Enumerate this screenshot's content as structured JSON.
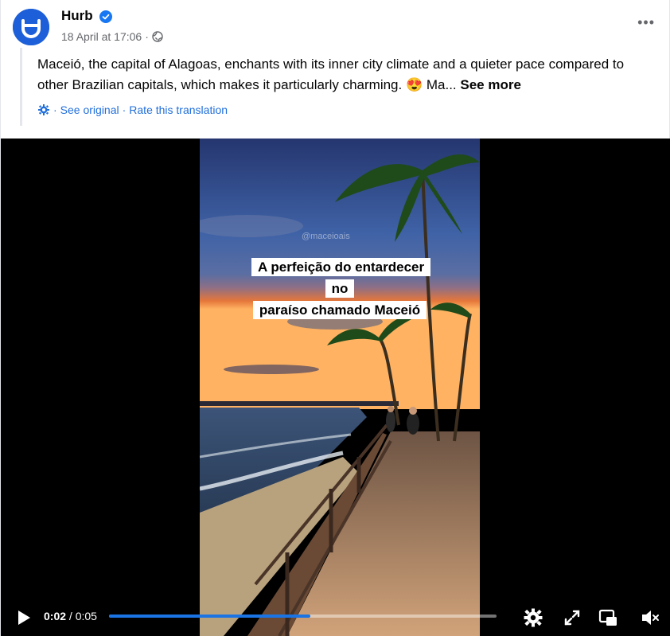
{
  "post": {
    "author": "Hurb",
    "date": "18 April at 17:06",
    "separator": "·",
    "text": "Maceió, the capital of Alagoas, enchants with its inner city climate and a quieter pace compared to other Brazilian capitals, which makes it particularly charming. 😍 Ma...",
    "see_more": "See more",
    "translation": {
      "see_original": "See original",
      "rate": "Rate this translation"
    }
  },
  "video": {
    "overlay_line1": "A perfeição do entardecer no",
    "overlay_line2": "paraíso chamado Maceió",
    "watermark": "@maceioais",
    "current_time": "0:02",
    "duration": "0:05",
    "time_sep": " / ",
    "progress_fraction": 0.52
  },
  "icons": {
    "avatar": "hurb-logo-icon",
    "verified": "verified-badge-icon",
    "privacy": "globe-icon",
    "more": "more-options-icon",
    "translate": "gear-icon",
    "play": "play-icon",
    "settings": "settings-gear-icon",
    "fullscreen": "fullscreen-icon",
    "pip": "picture-in-picture-icon",
    "volume": "muted-speaker-icon"
  },
  "colors": {
    "link": "#216fdb",
    "brand": "#1c5fd9",
    "progress": "#1b74e4"
  }
}
